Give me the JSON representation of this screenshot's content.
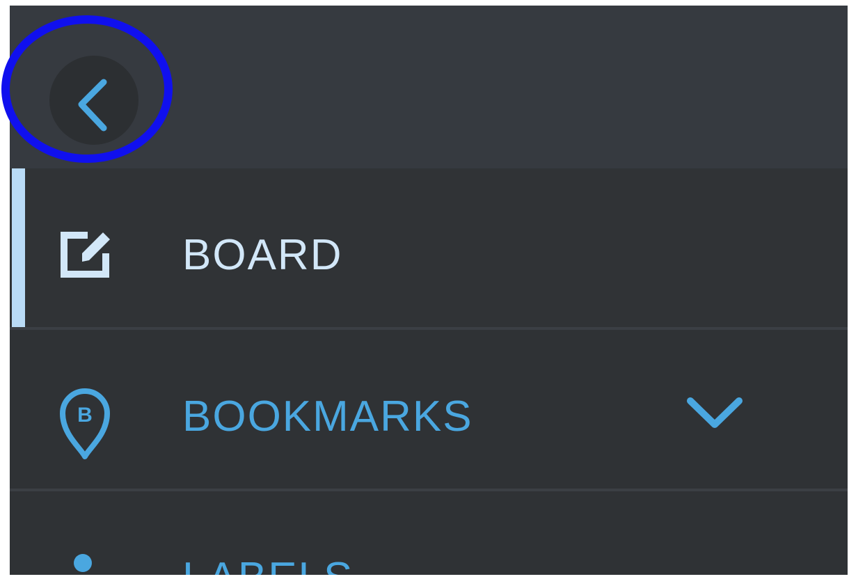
{
  "header": {
    "back_button": {
      "icon": "chevron-left-icon",
      "aria": "Back"
    }
  },
  "nav": {
    "items": [
      {
        "label": "BOARD",
        "icon": "edit-icon",
        "active": true
      },
      {
        "label": "BOOKMARKS",
        "icon": "bookmark-pin-icon",
        "icon_letter": "B",
        "expand_icon": "chevron-down-icon"
      },
      {
        "label": "LABELS",
        "icon": "dot-icon"
      }
    ]
  },
  "colors": {
    "panel_bg": "#2f3235",
    "header_bg": "#363a40",
    "accent": "#4aa7e0",
    "active_text": "#d2e7f8",
    "active_bar": "#b9dbf6",
    "highlight_ring": "#1010ee"
  }
}
